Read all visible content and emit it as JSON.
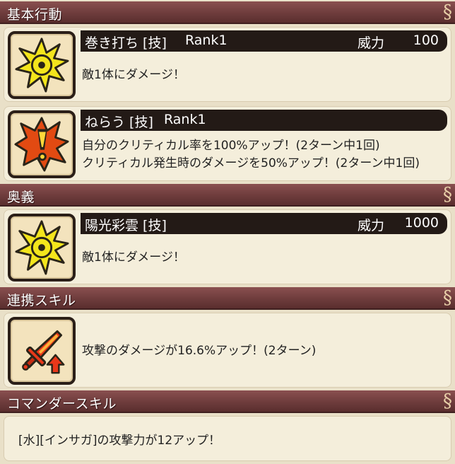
{
  "sections": {
    "basic": "基本行動",
    "ougi": "奥義",
    "combo": "連携スキル",
    "commander": "コマンダースキル"
  },
  "skills": [
    {
      "name": "巻き打ち [技]",
      "rank": "Rank1",
      "power_label": "威力",
      "power": "100",
      "desc": [
        "敵1体にダメージ！"
      ],
      "icon": "burst-icon"
    },
    {
      "name": "ねらう [技]",
      "rank": "Rank1",
      "power_label": "",
      "power": "",
      "desc": [
        "自分のクリティカル率を100%アップ！(2ターン中1回)",
        "クリティカル発生時のダメージを50%アップ！(2ターン中1回)"
      ],
      "icon": "critical-alert-icon"
    },
    {
      "name": "陽光彩雲 [技]",
      "rank": "",
      "power_label": "威力",
      "power": "1000",
      "desc": [
        "敵1体にダメージ！"
      ],
      "icon": "burst-icon"
    },
    {
      "name": "",
      "rank": "",
      "power_label": "",
      "power": "",
      "desc": [
        "攻撃のダメージが16.6%アップ！(2ターン)"
      ],
      "icon": "sword-attack-up-icon"
    }
  ],
  "commander_desc": "[水][インサガ]の攻撃力が12アップ！",
  "colors": {
    "header": "#6e3c3c",
    "card": "#f4eedb",
    "titlebar": "#231a16",
    "background": "#e9e0c8"
  }
}
